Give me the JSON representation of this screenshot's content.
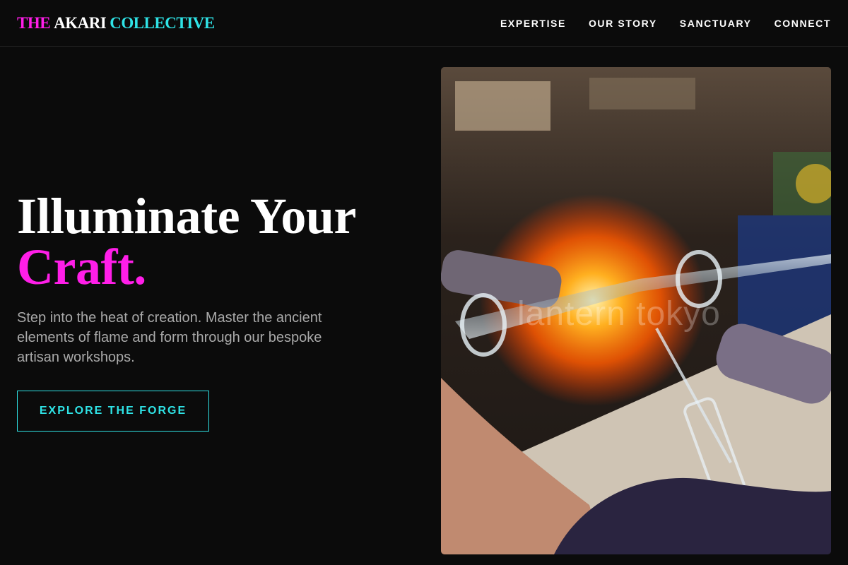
{
  "brand": {
    "word1": "THE",
    "word2": "AKARI",
    "word3": "COLLECTIVE"
  },
  "nav": {
    "items": [
      {
        "label": "EXPERTISE"
      },
      {
        "label": "OUR STORY"
      },
      {
        "label": "SANCTUARY"
      },
      {
        "label": "CONNECT"
      }
    ]
  },
  "hero": {
    "headline_line1": "Illuminate Your",
    "headline_line2": "Craft.",
    "subtext": "Step into the heat of creation. Master the ancient elements of flame and form through our bespoke artisan workshops.",
    "cta_label": "EXPLORE THE FORGE",
    "image_watermark": "lantern tokyo"
  },
  "colors": {
    "background": "#0b0b0b",
    "accent_magenta": "#ff1ee8",
    "accent_cyan": "#2fe3e6",
    "body_text": "#a9a9a9"
  }
}
